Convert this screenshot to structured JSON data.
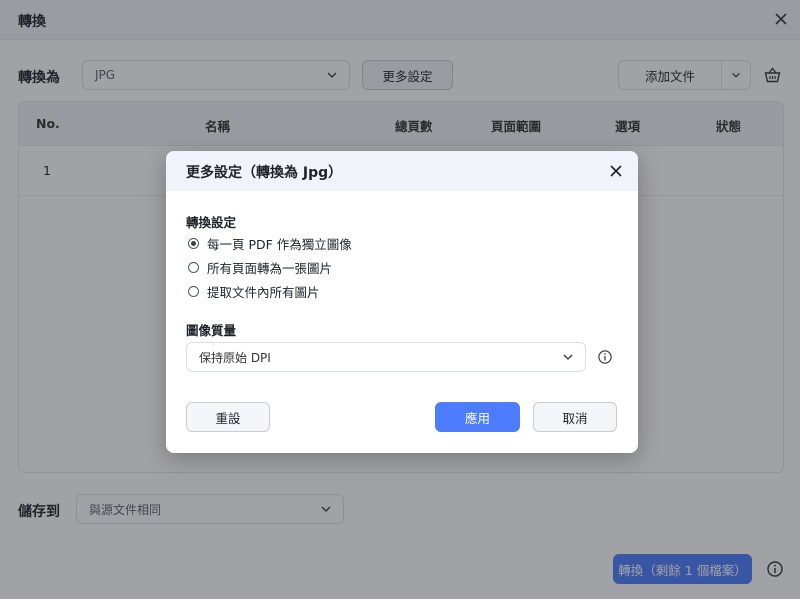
{
  "window": {
    "title": "轉換"
  },
  "convert_row": {
    "label": "轉換為",
    "format_value": "JPG",
    "more_settings_label": "更多設定",
    "add_file_label": "添加文件"
  },
  "table": {
    "columns": [
      "No.",
      "名稱",
      "總頁數",
      "頁面範圍",
      "選項",
      "狀態"
    ],
    "rows": [
      {
        "no": "1"
      }
    ]
  },
  "save_row": {
    "label": "儲存到",
    "value": "與源文件相同"
  },
  "convert_button": {
    "label": "轉換（剩餘 1 個檔案）"
  },
  "dialog": {
    "title": "更多設定（轉換為 Jpg）",
    "convert_settings": {
      "title": "轉換設定",
      "options": [
        {
          "label": "每一頁 PDF 作為獨立圖像",
          "checked": true
        },
        {
          "label": "所有頁面轉為一張圖片",
          "checked": false
        },
        {
          "label": "提取文件內所有圖片",
          "checked": false
        }
      ]
    },
    "image_quality": {
      "title": "圖像質量",
      "value": "保持原始 DPI"
    },
    "buttons": {
      "reset": "重設",
      "apply": "應用",
      "cancel": "取消"
    }
  },
  "colors": {
    "primary": "#4d7cfe",
    "header_bg": "#f0f3f9",
    "overlay": "rgba(30,33,40,0.42)"
  }
}
